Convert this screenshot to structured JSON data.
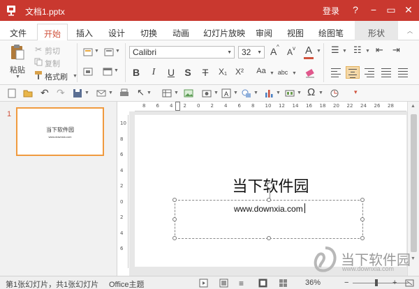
{
  "titlebar": {
    "doc_title": "文档1.pptx",
    "login": "登录",
    "help": "?",
    "minimize": "−",
    "restore": "▭",
    "close": "✕",
    "color": "#c9382f"
  },
  "menu": {
    "file": "文件",
    "home": "开始",
    "insert": "插入",
    "design": "设计",
    "transition": "切换",
    "animation": "动画",
    "slideshow": "幻灯片放映",
    "review": "审阅",
    "view": "视图",
    "pen": "绘图笔",
    "shape": "形状"
  },
  "ribbon": {
    "paste": "粘贴",
    "cut": "剪切",
    "copy": "复制",
    "format_painter": "格式刷",
    "font_name": "Calibri",
    "font_size": "32",
    "bold": "B",
    "italic": "I",
    "underline": "U",
    "strike_s": "S",
    "strike_t": "T",
    "subscript": "X₁",
    "superscript": "X²",
    "grow": "A",
    "shrink": "A",
    "font_color": "A",
    "clear_format": "Aa",
    "char_spacing": "abc",
    "accent_color": "#d0523c"
  },
  "slide": {
    "title": "当下软件园",
    "body": "www.downxia.com"
  },
  "thumbnail": {
    "number": "1",
    "title": "当下软件园",
    "body": "www.downxia.com"
  },
  "ruler": {
    "horizontal": [
      "8",
      "6",
      "4",
      "2",
      "0",
      "2",
      "4",
      "6",
      "8",
      "10",
      "12",
      "14",
      "16",
      "18",
      "20",
      "22",
      "24",
      "26",
      "28"
    ],
    "vertical": [
      "10",
      "8",
      "6",
      "4",
      "2",
      "0",
      "2",
      "4",
      "6"
    ]
  },
  "status": {
    "slide_info": "第1张幻灯片，共1张幻灯片",
    "theme": "Office主题",
    "zoom": "36%",
    "zoom_minus": "−",
    "zoom_plus": "+"
  },
  "watermark": {
    "text": "当下软件园",
    "sub": "www.downxia.com"
  }
}
